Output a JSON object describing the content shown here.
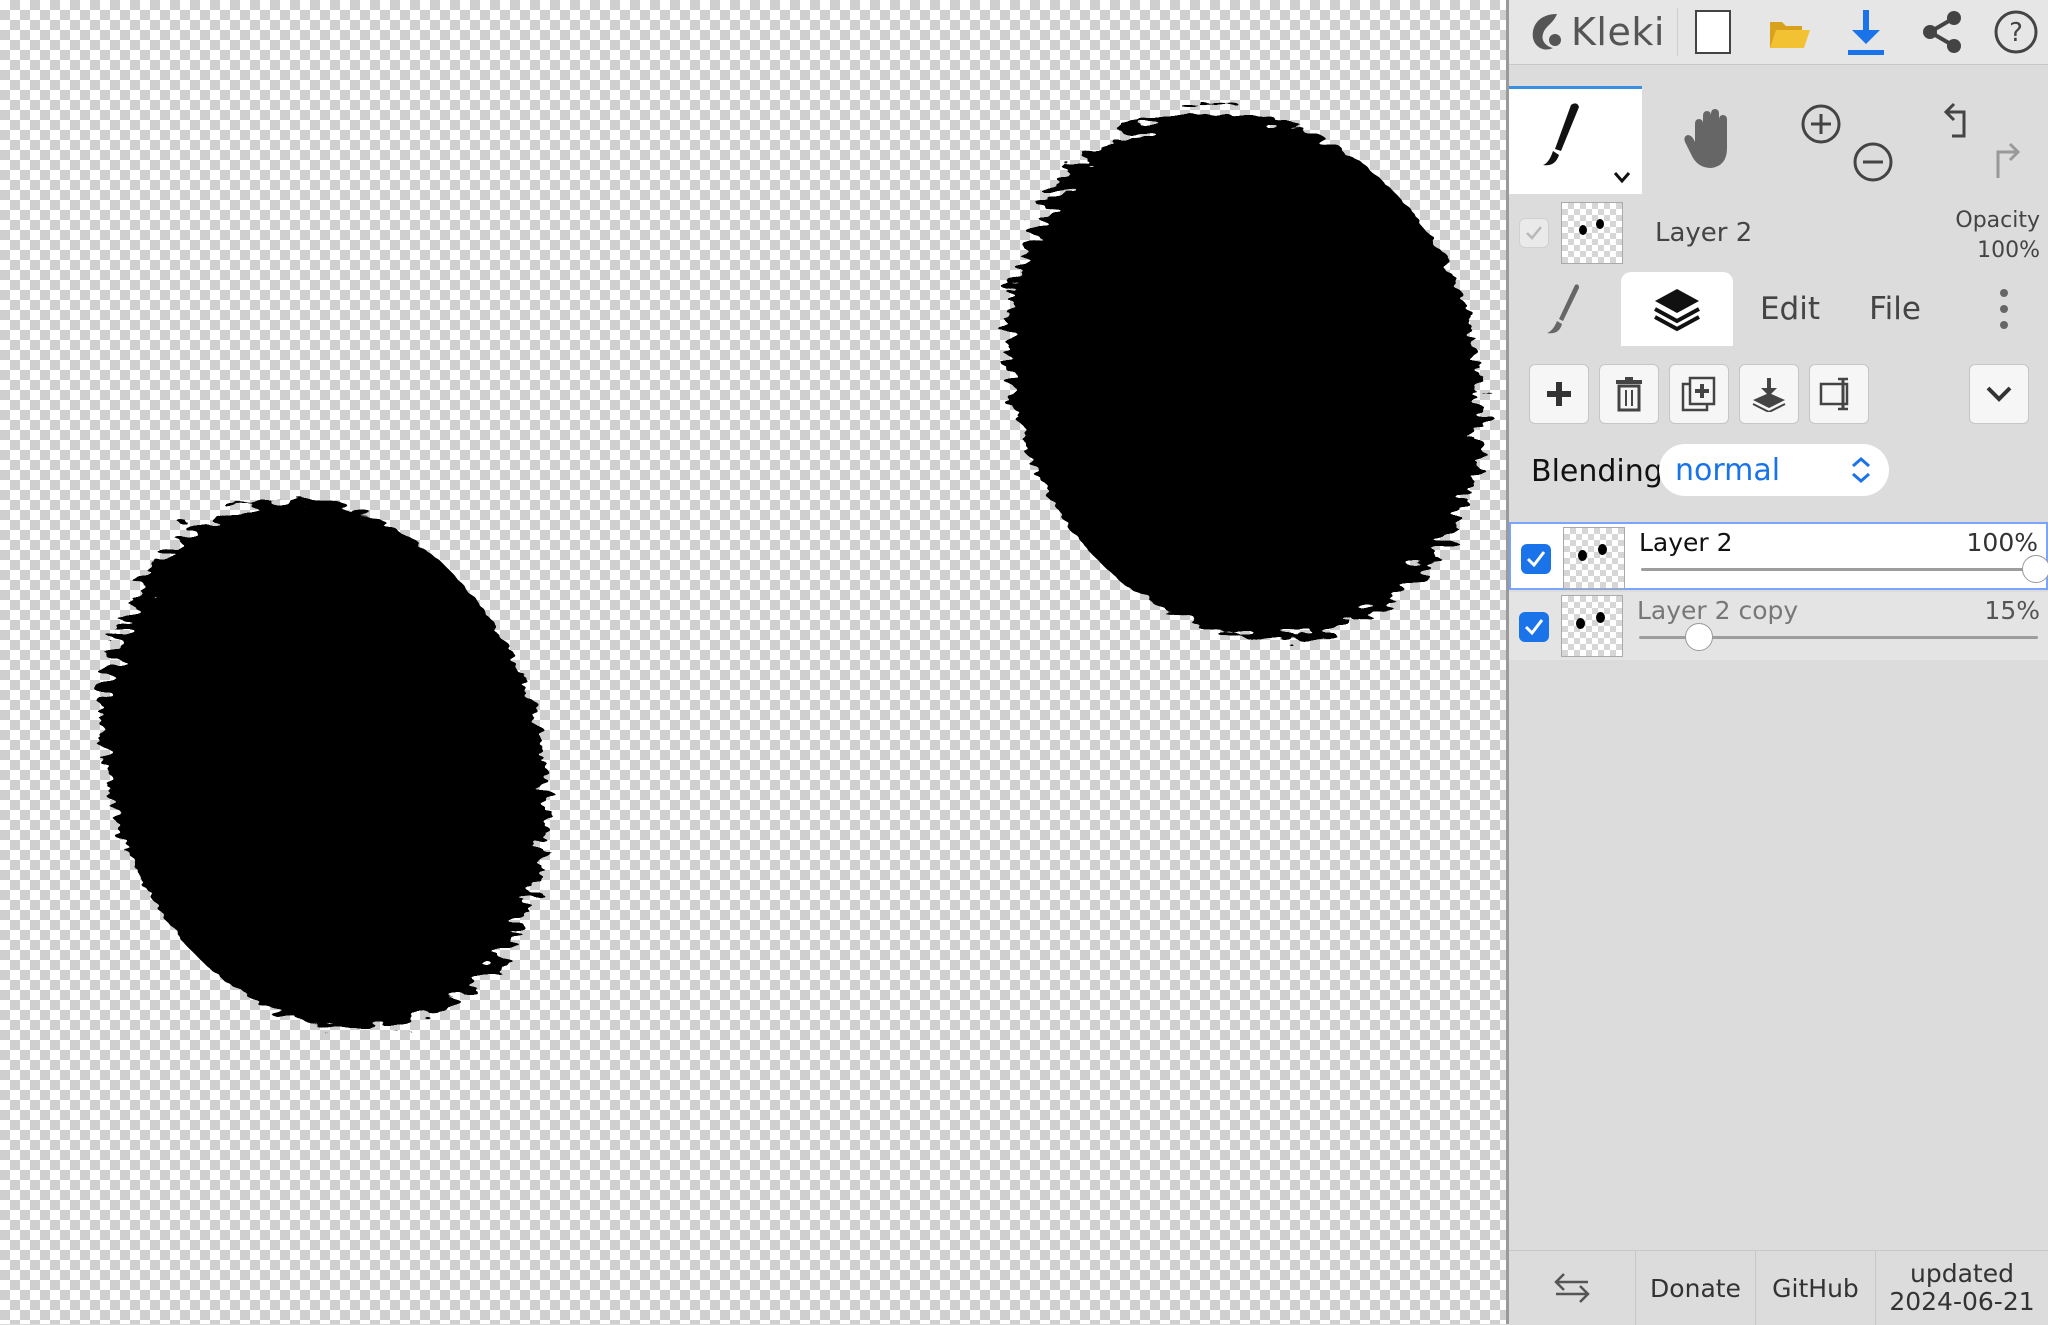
{
  "app": {
    "name": "Kleki"
  },
  "topbar": {
    "icons": [
      "kleki-logo-icon",
      "new-image-icon",
      "open-folder-icon",
      "download-icon",
      "share-icon",
      "help-icon"
    ],
    "colors": {
      "folder": "#f3c233",
      "download": "#1a73e8"
    }
  },
  "tools": {
    "items": [
      "brush-tool",
      "hand-tool",
      "zoom-in",
      "zoom-out",
      "undo",
      "redo"
    ],
    "active": "brush-tool",
    "accent": "#3b8fe0"
  },
  "current_layer": {
    "name": "Layer 2",
    "opacity_label": "Opacity",
    "opacity_value": "100%"
  },
  "tabs": {
    "edit": "Edit",
    "file": "File",
    "active": "layers"
  },
  "layer_actions": [
    "add-layer",
    "delete-layer",
    "duplicate-layer",
    "merge-down",
    "rename-layer",
    "more-dropdown"
  ],
  "blending": {
    "label": "Blending",
    "value": "normal"
  },
  "layers": [
    {
      "name": "Layer 2",
      "opacity": "100%",
      "opacity_fraction": 1.0,
      "visible": true,
      "selected": true
    },
    {
      "name": "Layer 2 copy",
      "opacity": "15%",
      "opacity_fraction": 0.15,
      "visible": true,
      "selected": false
    }
  ],
  "footer": {
    "donate": "Donate",
    "github": "GitHub",
    "updated_label": "updated",
    "updated_date": "2024-06-21"
  }
}
